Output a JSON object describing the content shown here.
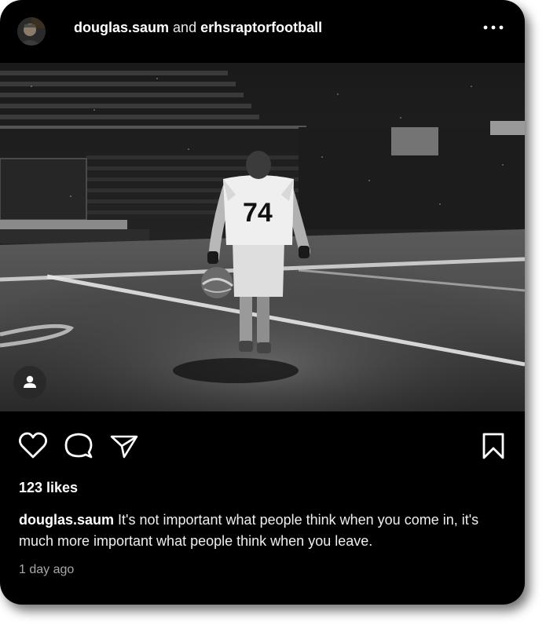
{
  "post": {
    "author": "douglas.saum",
    "conjunction": "and",
    "coauthor": "erhsraptorfootball",
    "more_icon": "more-horizontal-icon",
    "image": {
      "jersey_number": "74",
      "tag_icon": "person-tag-icon"
    },
    "actions": {
      "like_icon": "heart-icon",
      "comment_icon": "comment-icon",
      "share_icon": "send-icon",
      "save_icon": "bookmark-icon"
    },
    "likes": "123 likes",
    "caption_user": "douglas.saum",
    "caption_text": "It's not important what people think when you come in, it's much more important what people think when you leave.",
    "timestamp": "1 day ago"
  },
  "colors": {
    "card_bg": "#000000",
    "text": "#f5f5f5",
    "muted": "#a8a8a8"
  }
}
